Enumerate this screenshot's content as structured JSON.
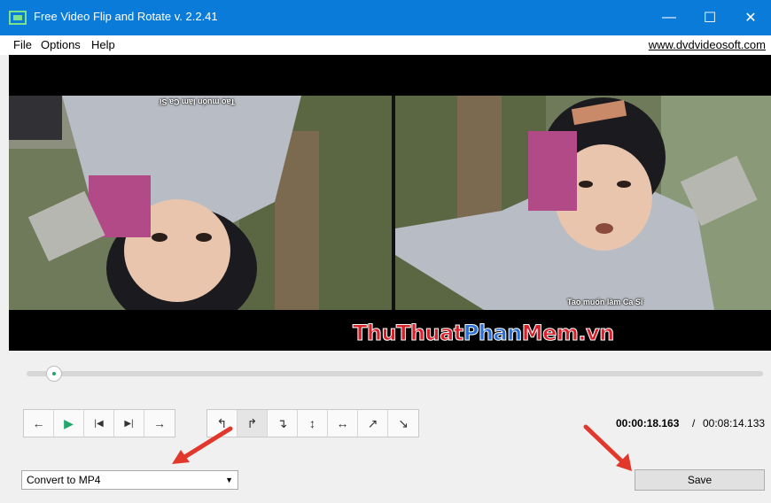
{
  "window": {
    "title": "Free Video Flip and Rotate v. 2.2.41",
    "minimize_glyph": "—",
    "maximize_glyph": "☐",
    "close_glyph": "✕"
  },
  "menu": {
    "items": [
      "File",
      "Options",
      "Help"
    ],
    "site_link": "www.dvdvideosoft.com"
  },
  "video": {
    "subtitle_left": "Tao muốn làm Ca Sĩ",
    "subtitle_right": "Tao muốn làm Ca Sĩ"
  },
  "watermark": {
    "part1": "Thu",
    "part2": "Thuat",
    "part3": "Phan",
    "part4": "Mem",
    "part5": ".vn",
    "colors": {
      "red": "#d81f2a",
      "blue": "#2a6fd6"
    }
  },
  "playback": {
    "position_fraction": 0.037,
    "buttons": {
      "prev_frame": "←",
      "play": "▶",
      "to_start": "|◀",
      "to_end": "▶|",
      "next_frame": "→"
    }
  },
  "rotate_tools": {
    "icons": [
      "rotate-left-icon",
      "rotate-right-icon",
      "rotate-cw-90-icon",
      "flip-vertical-icon",
      "flip-horizontal-icon",
      "diagonal-ne-icon",
      "diagonal-se-icon"
    ],
    "glyphs": [
      "↰",
      "↱",
      "↴",
      "↕",
      "↔",
      "↗",
      "↘"
    ]
  },
  "time": {
    "current": "00:00:18.163",
    "separator": "/",
    "total": "00:08:14.133"
  },
  "output": {
    "format_selected": "Convert to MP4",
    "save_label": "Save"
  },
  "colors": {
    "titlebar": "#0a7bd8",
    "play_green": "#22a66a",
    "annotation_red": "#e2382c"
  }
}
